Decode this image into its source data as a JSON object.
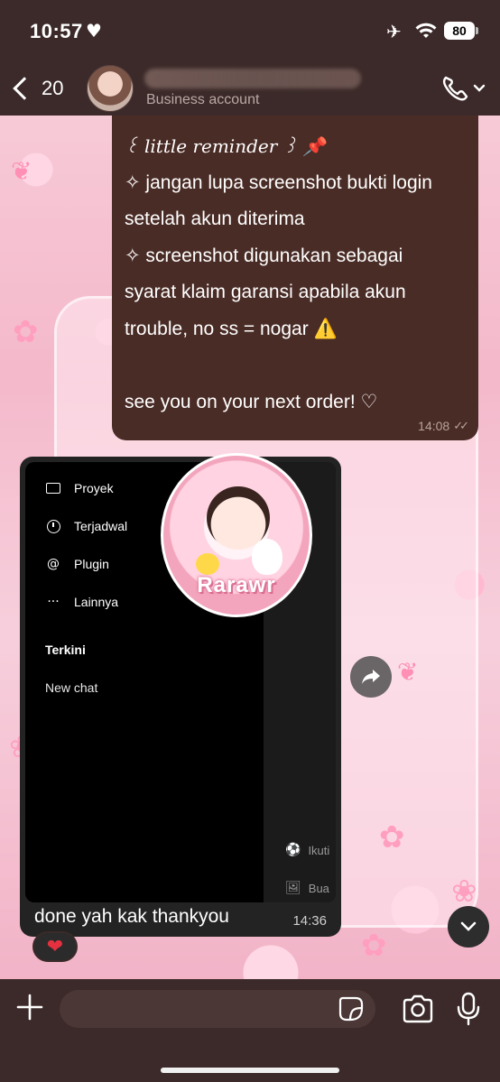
{
  "status_bar": {
    "time": "10:57",
    "heart": "♥",
    "airplane": "✈",
    "battery": "80"
  },
  "header": {
    "back_count": "20",
    "subtitle": "Business account"
  },
  "messages": {
    "outgoing": {
      "lines": [
        "꒰ little reminder ꒱ 📌",
        "✧ jangan lupa screenshot bukti login",
        "setelah akun diterima",
        "✧ screenshot digunakan sebagai",
        "syarat klaim garansi apabila akun",
        "trouble, no ss = nogar ⚠️",
        "",
        "see you on your next order! ♡"
      ],
      "time": "14:08",
      "ticks": "✓✓"
    },
    "incoming": {
      "screenshot": {
        "menu": [
          {
            "label": "Proyek",
            "icon": "folder-icon"
          },
          {
            "label": "Terjadwal",
            "icon": "clock-icon"
          },
          {
            "label": "Plugin",
            "icon": "at-icon"
          },
          {
            "label": "Lainnya",
            "icon": "more-icon"
          }
        ],
        "section_title": "Terkini",
        "new_chat": "New chat",
        "side_items": [
          {
            "label": "Ikuti",
            "icon": "⚽"
          },
          {
            "label": "Bua",
            "icon": "🖼"
          }
        ]
      },
      "sticker_text": "Rarawr",
      "caption": "done yah kak thankyou",
      "time": "14:36",
      "reaction": "❤"
    }
  },
  "input": {
    "placeholder": "",
    "value": ""
  },
  "colors": {
    "chat_bar": "#3b2a29",
    "outgoing_bubble": "#4a2c26",
    "incoming_bubble": "#232323",
    "wallpaper_pink": "#f4b9cb"
  }
}
